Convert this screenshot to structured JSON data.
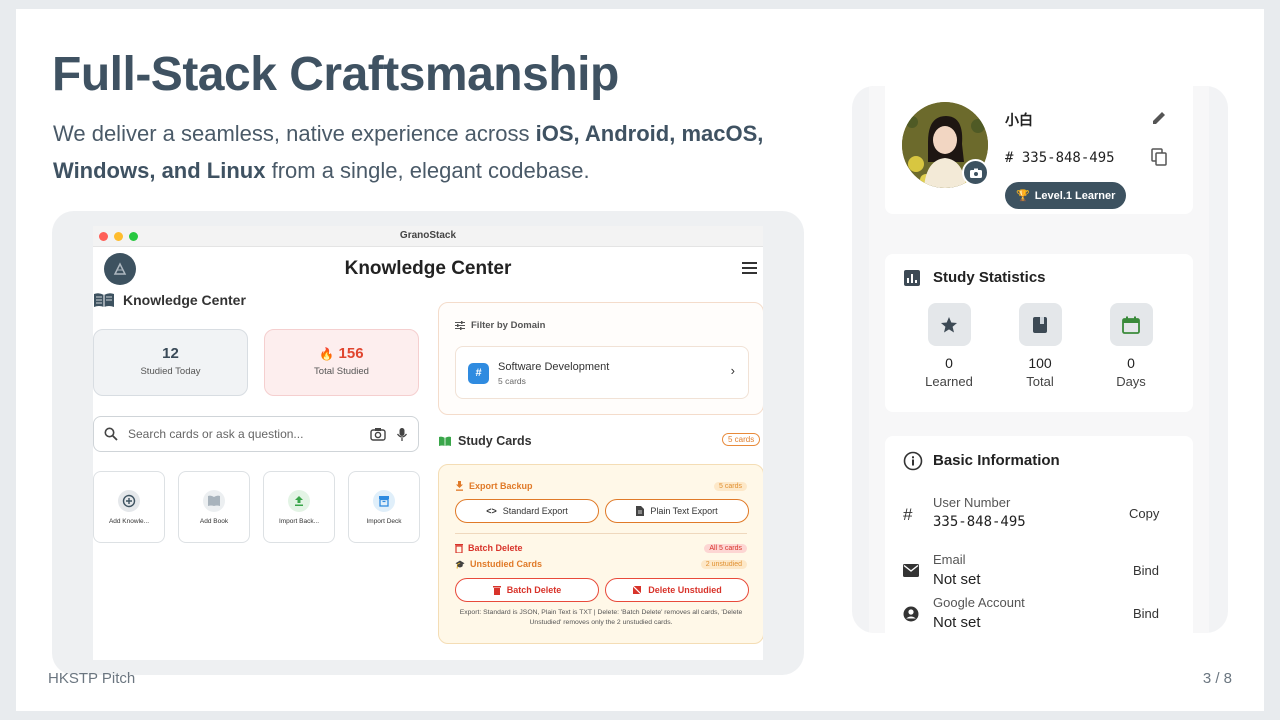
{
  "slide": {
    "title": "Full-Stack Craftsmanship",
    "subtitle_parts": [
      "We deliver a seamless, native experience across ",
      "iOS, Android, macOS, Windows, and Linux",
      " from a single, elegant codebase."
    ],
    "footer_left": "HKSTP Pitch",
    "footer_right": "3 / 8"
  },
  "desktop_app": {
    "window_title": "GranoStack",
    "app_title": "Knowledge Center",
    "section_title": "Knowledge Center",
    "studied_today_value": "12",
    "studied_today_label": "Studied Today",
    "total_studied_value": "156",
    "total_studied_label": "Total Studied",
    "search_placeholder": "Search cards or ask a question...",
    "quick_actions": [
      "Add Knowle...",
      "Add Book",
      "Import Back...",
      "Import Deck"
    ],
    "filter_title": "Filter by Domain",
    "domain_name": "Software Development",
    "domain_count": "5 cards",
    "study_cards_title": "Study Cards",
    "study_cards_badge": "5 cards",
    "export_backup": "Export Backup",
    "export_badge": "5 cards",
    "standard_export": "Standard Export",
    "plain_text_export": "Plain Text Export",
    "batch_delete": "Batch Delete",
    "batch_badge": "All 5 cards",
    "unstudied_cards": "Unstudied Cards",
    "unstudied_badge": "2 unstudied",
    "batch_delete_btn": "Batch Delete",
    "delete_unstudied_btn": "Delete Unstudied",
    "note": "Export: Standard is JSON, Plain Text is TXT | Delete: 'Batch Delete' removes all cards, 'Delete Unstudied' removes only the 2 unstudied cards."
  },
  "profile": {
    "name": "小白",
    "user_id": "# 335-848-495",
    "level": "Level.1 Learner",
    "stats_title": "Study Statistics",
    "stats": [
      {
        "value": "0",
        "label": "Learned",
        "icon": "star-icon"
      },
      {
        "value": "100",
        "label": "Total",
        "icon": "book-icon"
      },
      {
        "value": "0",
        "label": "Days",
        "icon": "calendar-icon"
      }
    ],
    "basic_title": "Basic Information",
    "rows": [
      {
        "key": "User Number",
        "value": "335-848-495",
        "action": "Copy"
      },
      {
        "key": "Email",
        "value": "Not set",
        "action": "Bind"
      },
      {
        "key": "Google Account",
        "value": "Not set",
        "action": "Bind"
      }
    ]
  },
  "colors": {
    "primary": "#3d5260",
    "accent_orange": "#e07a28",
    "danger": "#e84a3a",
    "flame": "#e0452f",
    "blue": "#2f8be0"
  }
}
